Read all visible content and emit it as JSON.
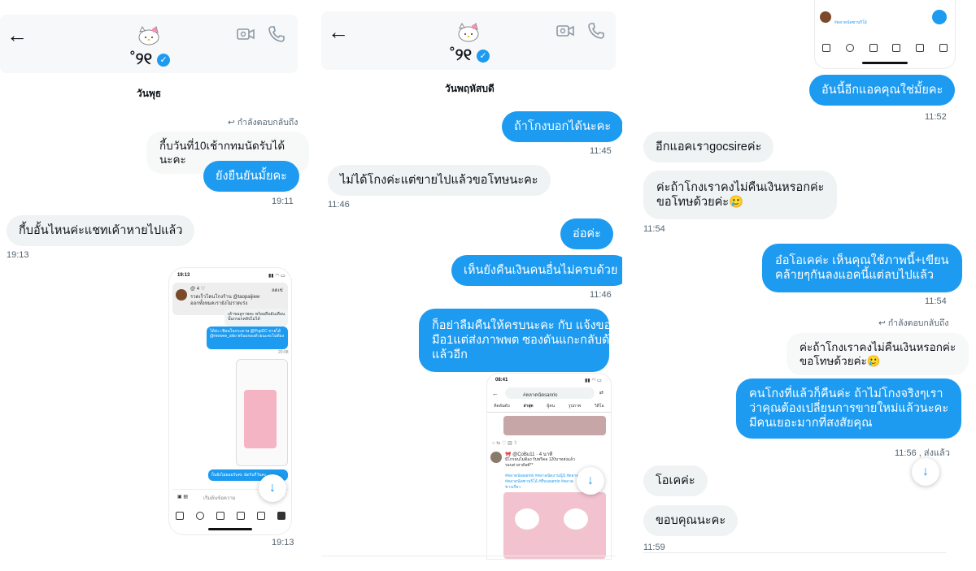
{
  "panel1": {
    "contact_name": "˚୨୧",
    "day": "วันพุธ",
    "reply_label": "กำลังตอบกลับถึง",
    "quoted": "กี้บวันที่10เช้ากทมนัดรับได้นะคะ",
    "msg_out_1": "ยังยืนยันมั้ยคะ",
    "time_1": "19:11",
    "msg_in_1": "กี้บอั้นไหนค่ะแชทเค้าหายไปแล้ว",
    "time_2": "19:13",
    "time_3": "19:13",
    "shot": {
      "status_time": "19:13",
      "top_user": "@ 4 ♡",
      "top_text": "รวดเร็วโดนโกงร้าน @taopaijiew",
      "top_text2": "ออกทั้งหมดเรายังไม่รวดเร่ง",
      "close": "ลดเข่",
      "grey_text": "เค้าขอลูกาพคะ พร้อมยืนยันเดือนนั้นกรอกคลิปไม่ได้",
      "blue_text": "ได้ค่ะ เขียนในกระดาษ @PupDC ขายได้ @mewee_siko พร้อมของด้วยนะค่ะไม่ต้อง",
      "blue_time": "20:08",
      "bottom_blue": "ก็บยังไม่ยอมรับค่ะ นัดรับกี่วันคะ",
      "input_placeholder": "เริ่มต้นข้อความ"
    }
  },
  "panel2": {
    "contact_name": "˚୨୧",
    "day": "วันพฤหัสบดี",
    "msg_out_1": "ถ้าโกงบอกได้นะคะ",
    "time_1": "11:45",
    "msg_in_1": "ไม่ได้โกงค่ะแต่ขายไปแล้วขอโทษนะคะ",
    "time_2": "11:46",
    "msg_out_2": "อ่อค่ะ",
    "msg_out_3": "เห็นยังคืนเงินคนอื่นไม่ครบด้วย",
    "time_3": "11:46",
    "msg_out_4_l1": "ก็อย่าลืมคืนให้ครบนะคะ กับ แจ้งของ",
    "msg_out_4_l2": "มีอ1แต่ส่งภาพพต ซองดันแกะกลับด้าน",
    "msg_out_4_l3": "แล้วอีก",
    "shot": {
      "status_time": "08:41",
      "search": "#ตลาดนัดsanrio",
      "tabs": [
        "ติดอันดับ",
        "ล่าสุด",
        "ผู้คน",
        "รูปภาพ",
        "วิดีโอ"
      ],
      "poster": "🎀 @CoBu11 · 4 นาที",
      "post_l1": "มีโกรธนไม่ต้อง รับพรีคล 120บาทส่งแล้ว",
      "post_l2": "รอบค่าสาคัลต์**",
      "post_l3": "#ตลาดนัดsanrio #ตลาดนัดงานนู้นั #ตลาด",
      "post_l4": "#ตลาดนัดซานริโอ้ #ที่บนsanrio #ตลาด",
      "post_l5": "ชางเกี่ยว"
    }
  },
  "panel3": {
    "msg_out_1": "อันนี้อีกแอคคุณใช่มั้ยคะ",
    "time_1": "11:52",
    "msg_in_1": "อีกแอคเราgocsireค่ะ",
    "msg_in_2_l1": "ค่ะถ้าโกงเราคงไม่คืนเงินหรอกค่ะ",
    "msg_in_2_l2": "ขอโทษด้วยค่ะ🥲",
    "time_2": "11:54",
    "msg_out_2_l1": "อ๋อโอเคค่ะ เห็นคุณใช้ภาพนี้+เขียน",
    "msg_out_2_l2": "คล้ายๆกันลงแอคนี้แต่ลบไปแล้ว",
    "time_3": "11:54",
    "reply_label": "กำลังตอบกลับถึง",
    "quoted_l1": "ค่ะถ้าโกงเราคงไม่คืนเงินหรอกค่ะ",
    "quoted_l2": "ขอโทษด้วยค่ะ🥲",
    "msg_out_3_l1": "คนโกงที่แล้วก็คืนค่ะ ถ้าไม่โกงจริงๆเรา",
    "msg_out_3_l2": "ว่าคุณต้องเปลี่ยนการขายใหม่แล้วนะคะ",
    "msg_out_3_l3": "มีคนเยอะมากที่สงสัยคุณ",
    "time_4": "11:56 , ส่งแล้ว",
    "msg_in_3": "โอเคค่ะ",
    "msg_in_4": "ขอบคุณนะคะ",
    "time_5": "11:59",
    "shot_top_text": "#ตลาดนัดซานริโอ้"
  },
  "colors": {
    "accent": "#1d9bf0",
    "incoming": "#eff3f4",
    "muted": "#536471"
  }
}
